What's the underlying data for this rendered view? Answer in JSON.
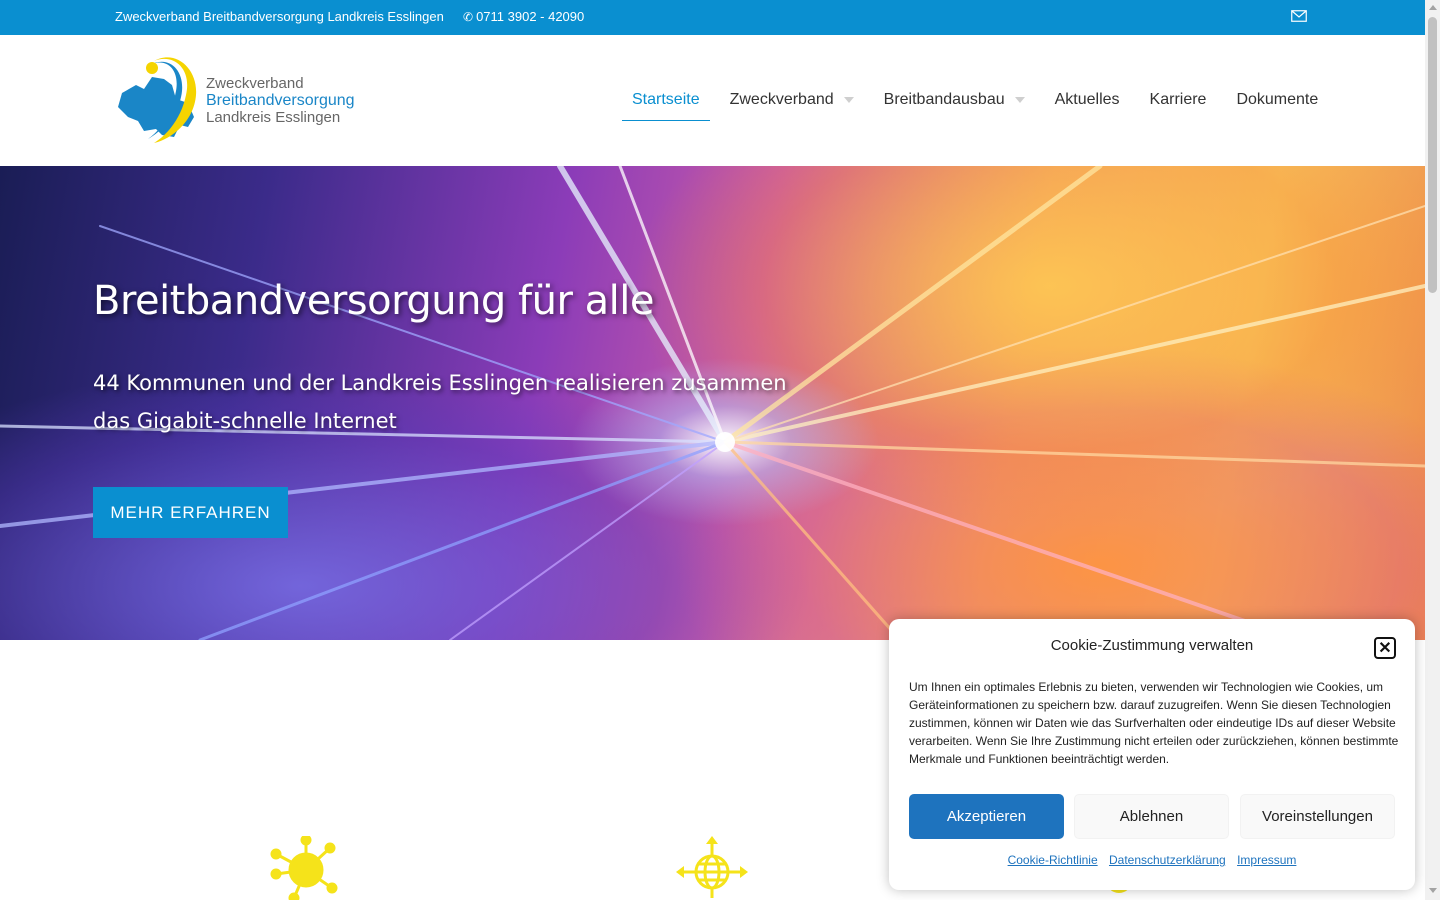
{
  "topbar": {
    "org_name": "Zweckverband Breitbandversorgung Landkreis Esslingen",
    "phone": "0711 3902 - 42090",
    "phone_icon": "phone-icon",
    "mail_icon": "envelope-icon"
  },
  "logo": {
    "line1": "Zweckverband",
    "line2": "Breitbandversorgung",
    "line3": "Landkreis Esslingen"
  },
  "nav": {
    "items": [
      {
        "label": "Startseite",
        "active": true
      },
      {
        "label": "Zweckverband",
        "dropdown": true
      },
      {
        "label": "Breitbandausbau",
        "dropdown": true
      },
      {
        "label": "Aktuelles"
      },
      {
        "label": "Karriere"
      },
      {
        "label": "Dokumente"
      }
    ]
  },
  "hero": {
    "title": "Breitbandversorgung für alle",
    "subtitle": "44 Kommunen und der Landkreis Esslingen realisieren zusammen das Gigabit-schnelle Internet",
    "cta_label": "MEHR ERFAHREN"
  },
  "features": {
    "icons": [
      "network-hub-icon",
      "globe-arrows-icon",
      "feature-icon"
    ],
    "icon_color": "#f5e31a"
  },
  "cookie": {
    "title": "Cookie-Zustimmung verwalten",
    "close_icon": "close-icon",
    "text": "Um Ihnen ein optimales Erlebnis zu bieten, verwenden wir Technologien wie Cookies, um Geräteinformationen zu speichern bzw. darauf zuzugreifen. Wenn Sie diesen Technologien zustimmen, können wir Daten wie das Surfverhalten oder eindeutige IDs auf dieser Website verarbeiten. Wenn Sie Ihre Zustimmung nicht erteilen oder zurückziehen, können bestimmte Merkmale und Funktionen beeinträchtigt werden.",
    "accept_label": "Akzeptieren",
    "deny_label": "Ablehnen",
    "prefs_label": "Voreinstellungen",
    "links": [
      "Cookie-Richtlinie",
      "Datenschutzerklärung",
      "Impressum"
    ]
  },
  "colors": {
    "primary": "#0a8fd0",
    "accept_button": "#1e73be",
    "logo_blue": "#1a86c7",
    "logo_yellow": "#f5d400"
  }
}
